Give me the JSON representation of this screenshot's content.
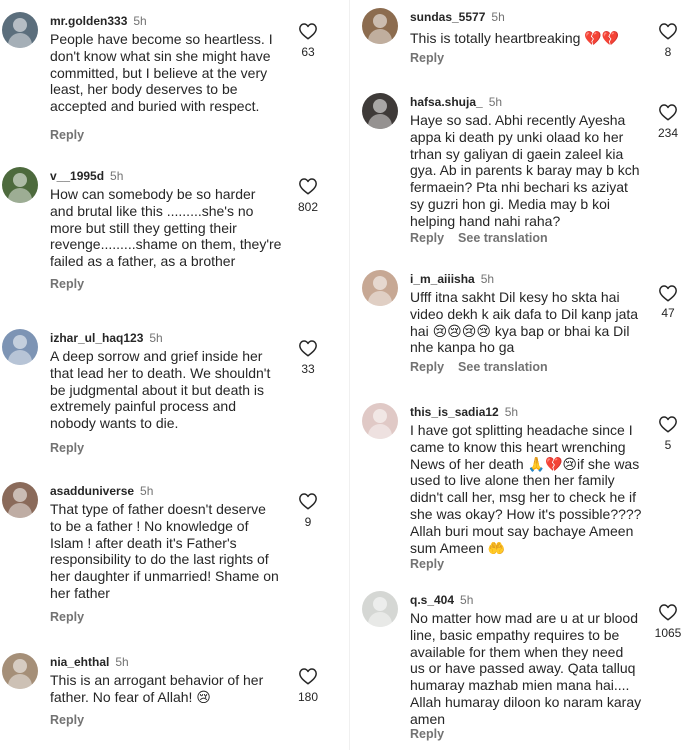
{
  "left": [
    {
      "user": "mr.golden333",
      "time": "5h",
      "text": "People have become so heartless. I\ndon't know what sin she might have\ncommitted, but I believe at the very\nleast, her body deserves to be\naccepted and buried with respect.",
      "likes": "63",
      "reply": "Reply",
      "avatar_color": "#5b6e7c"
    },
    {
      "user": "v__1995d",
      "time": "5h",
      "text": "How can somebody be so harder\nand brutal like this .........she's no\nmore but still they getting their\nrevenge.........shame on them, they're\nfailed as a father, as a brother",
      "likes": "802",
      "reply": "Reply",
      "avatar_color": "#4d6a3d"
    },
    {
      "user": "izhar_ul_haq123",
      "time": "5h",
      "text": "A deep sorrow and grief inside her\nthat lead her to death. We shouldn't\nbe judgmental about it but death is\nextremely painful process and\nnobody wants to die.",
      "likes": "33",
      "reply": "Reply",
      "avatar_color": "#7d94b4"
    },
    {
      "user": "asadduniverse",
      "time": "5h",
      "text": "That type of father doesn't deserve\nto be a father ! No knowledge of\nIslam ! after death it's Father's\nresponsibility to do the last rights of\nher daughter if unmarried! Shame on\nher father",
      "likes": "9",
      "reply": "Reply",
      "avatar_color": "#8a6a5a"
    },
    {
      "user": "nia_ehthal",
      "time": "5h",
      "text": "This is an arrogant behavior of her\nfather. No fear of Allah! 😢",
      "likes": "180",
      "reply": "Reply",
      "avatar_color": "#a58f78"
    }
  ],
  "right": [
    {
      "user": "sundas_5577",
      "time": "5h",
      "text": "This is totally heartbreaking 💔💔",
      "likes": "8",
      "reply": "Reply",
      "avatar_color": "#8c6c4f"
    },
    {
      "user": "hafsa.shuja_",
      "time": "5h",
      "text": "Haye so sad. Abhi recently Ayesha\nappa ki death py unki olaad ko her\ntrhan sy galiyan di gaein zaleel kia\ngya. Ab in parents k baray may b kch\nfermaein? Pta nhi bechari ks aziyat\nsy guzri hon gi. Media may b koi\nhelping hand nahi raha?",
      "likes": "234",
      "reply": "Reply",
      "translate": "See translation",
      "avatar_color": "#3e3a38"
    },
    {
      "user": "i_m_aiiisha",
      "time": "5h",
      "text": "Ufff itna sakht Dil kesy ho skta hai\nvideo dekh k aik dafa to Dil kanp jata\nhai 😢😢😢😢 kya bap or bhai ka Dil\nnhe kanpa ho ga",
      "likes": "47",
      "reply": "Reply",
      "translate": "See translation",
      "avatar_color": "#c7a894"
    },
    {
      "user": "this_is_sadia12",
      "time": "5h",
      "text": "I have got splitting headache since I\ncame to know this heart wrenching\nNews of her death 🙏💔😢if she was\nused to live alone then her family\ndidn't call her, msg her to check he if\nshe was okay? How it's possible????\nAllah buri mout say bachaye Ameen\nsum Ameen 🤲",
      "likes": "5",
      "reply": "Reply",
      "avatar_color": "#e0c9c6"
    },
    {
      "user": "q.s_404",
      "time": "5h",
      "text": "No matter how mad are u at ur blood\nline, basic empathy requires to be\navailable for them when they need\nus or have passed away. Qata talluq\nhumaray mazhab mien mana hai....\nAllah humaray diloon ko naram karay\namen",
      "likes": "1065",
      "reply": "Reply",
      "avatar_color": "#d5d7d4"
    }
  ]
}
